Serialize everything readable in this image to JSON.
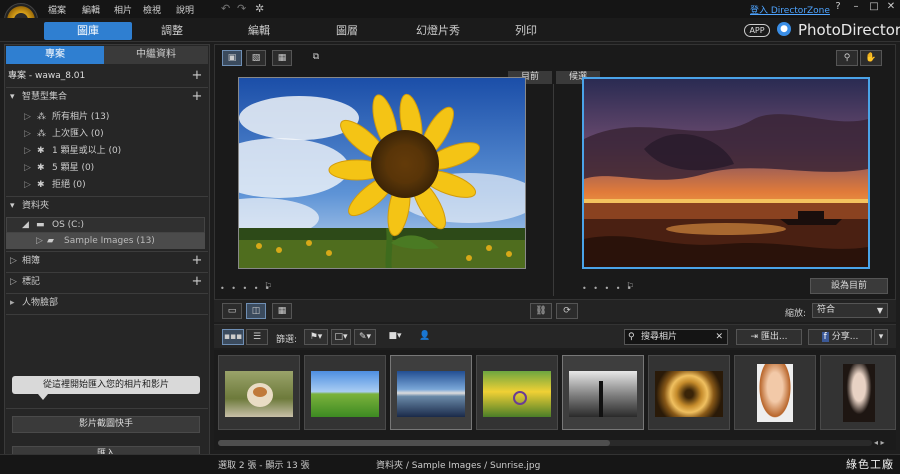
{
  "menu": [
    "檔案",
    "編輯",
    "相片",
    "檢視",
    "說明"
  ],
  "account": {
    "login_text": "登入 DirectorZone"
  },
  "brand": {
    "app_badge": "APP",
    "name": "PhotoDirector"
  },
  "modules": [
    "圖庫",
    "調整",
    "編輯",
    "圖層",
    "幻燈片秀",
    "列印"
  ],
  "left_panel": {
    "tabs": [
      "專案",
      "中繼資料"
    ],
    "project_name": "專案 - wawa_8.01",
    "smart_collections": {
      "header": "智慧型集合",
      "items": [
        "所有相片 (13)",
        "上次匯入 (0)",
        "1 顆星或以上 (0)",
        "5 顆星 (0)",
        "拒絕 (0)"
      ]
    },
    "folders": {
      "header": "資料夾",
      "drive": "OS (C:)",
      "folder": "Sample Images (13)"
    },
    "albums": "相簿",
    "tags": "標記",
    "faces": "人物臉部",
    "import_tip": "從這裡開始匯入您的相片和影片",
    "video_snapshot": "影片截圖快手",
    "import": "匯入"
  },
  "viewer": {
    "label_current": "目前",
    "label_candidate": "候選",
    "dots": "• • • • •",
    "set_current": "設為目前"
  },
  "zoom": {
    "label": "縮放:",
    "value": "符合"
  },
  "toolbar2": {
    "filter_label": "篩選:",
    "search_placeholder": "搜尋相片",
    "export": "匯出...",
    "share": "分享..."
  },
  "filmstrip": {
    "thumbnails": [
      "cat",
      "sheep-field",
      "lake-reflection",
      "bicycle",
      "pier-bw",
      "spiral",
      "portrait-woman",
      "portrait-girl"
    ]
  },
  "status": {
    "selection": "選取 2 張 - 顯示 13 張",
    "path": "資料夾 / Sample Images / Sunrise.jpg",
    "watermark": "綠色工廠"
  }
}
